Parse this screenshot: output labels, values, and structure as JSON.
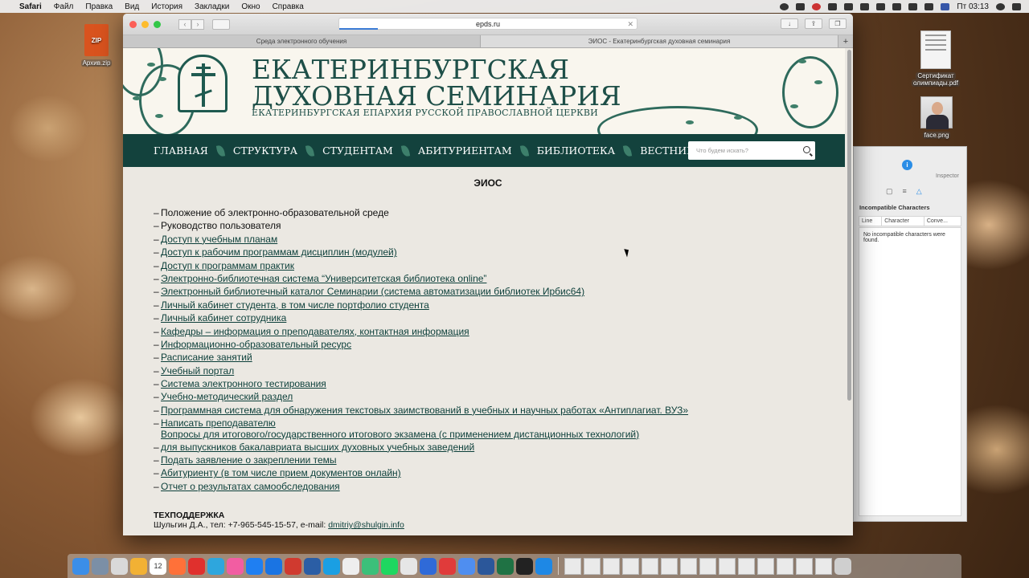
{
  "menubar": {
    "app": "Safari",
    "items": [
      "Файл",
      "Правка",
      "Вид",
      "История",
      "Закладки",
      "Окно",
      "Справка"
    ],
    "clock": "Пт 03:13"
  },
  "desktop": {
    "zip_label": "Архив.zip",
    "zip_badge": "ZIP",
    "pdf_label_1": "Сертификат",
    "pdf_label_2": "олимпиады.pdf",
    "png_label": "face.png"
  },
  "inspector": {
    "info_glyph": "i",
    "title": "Inspector",
    "heading": "Incompatible Characters",
    "columns": [
      "Line",
      "Character",
      "Conve..."
    ],
    "result": "No incompatible characters were found."
  },
  "browser": {
    "url": "epds.ru",
    "load_progress": 0.13,
    "tabs": [
      {
        "label": "Среда электронного обучения",
        "active": false
      },
      {
        "label": "ЭИОС - Екатеринбургская духовная семинария",
        "active": true
      }
    ]
  },
  "site": {
    "title_line1": "ЕКАТЕРИНБУРГСКАЯ",
    "title_line2": "ДУХОВНАЯ СЕМИНАРИЯ",
    "subtitle": "ЕКАТЕРИНБУРГСКАЯ ЕПАРХИЯ РУССКОЙ ПРАВОСЛАВНОЙ ЦЕРКВИ",
    "nav": [
      "ГЛАВНАЯ",
      "СТРУКТУРА",
      "СТУДЕНТАМ",
      "АБИТУРИЕНТАМ",
      "БИБЛИОТЕКА",
      "ВЕСТНИК ЕДС"
    ],
    "search_placeholder": "Что будем искать?",
    "page_title": "ЭИОС",
    "links": [
      {
        "text": "Положение об электронно-образовательной среде",
        "link": false
      },
      {
        "text": "Руководство пользователя",
        "link": false
      },
      {
        "text": "Доступ к учебным планам",
        "link": true
      },
      {
        "text": "Доступ к рабочим программам дисциплин (модулей)",
        "link": true
      },
      {
        "text": "Доступ к программам практик",
        "link": true
      },
      {
        "text": "Электронно-библиотечная система “Университетская библиотека online”",
        "link": true
      },
      {
        "text": "Электронный библиотечный каталог Семинарии (система автоматизации библиотек Ирбис64)",
        "link": true
      },
      {
        "text": "Личный кабинет студента, в том числе портфолио студента",
        "link": true
      },
      {
        "text": "Личный кабинет сотрудника",
        "link": true
      },
      {
        "text": "Кафедры – информация о преподавателях, контактная информация",
        "link": true
      },
      {
        "text": "Информационно-образовательный ресурс",
        "link": true
      },
      {
        "text": "Расписание занятий",
        "link": true
      },
      {
        "text": "Учебный портал",
        "link": true
      },
      {
        "text": "Система электронного тестирования",
        "link": true
      },
      {
        "text": "Учебно-методический раздел",
        "link": true
      },
      {
        "text": "Программная система для обнаружения текстовых заимствований в учебных и научных работах «Антиплагиат. ВУЗ»",
        "link": true
      },
      {
        "text": "Написать преподавателю",
        "link": true
      },
      {
        "text": "Вопросы для итогового/государственного итогового экзамена (с применением дистанционных технологий)",
        "link": true,
        "indent": true
      },
      {
        "text": "для выпускников бакалавриата высших духовных учебных заведений",
        "link": true
      },
      {
        "text": "Подать заявление о закреплении темы",
        "link": true
      },
      {
        "text": "Абитуриенту (в том числе прием документов онлайн)",
        "link": true
      },
      {
        "text": "Отчет о результатах самообследования",
        "link": true
      }
    ],
    "dash": "–",
    "support_label": "ТЕХПОДДЕРЖКА",
    "support_text": "Шульгин Д.А., тел: +7-965-545-15-57, e-mail: ",
    "support_email": "dmitriy@shulgin.info"
  },
  "dock": {
    "calendar_day": "12",
    "icons": [
      "finder-icon",
      "launchpad-icon",
      "notes-icon",
      "chrome-icon",
      "calendar-icon",
      "firefox-icon",
      "opera-icon",
      "telegram-icon",
      "itunes-icon",
      "appstore-icon",
      "trello-icon",
      "tool-icon",
      "bitwarden-icon",
      "skype-icon",
      "ia-writer-icon",
      "affinity-icon",
      "spotify-icon",
      "chrome2-icon",
      "cloud-icon",
      "anydesk-icon",
      "browser-icon",
      "word-icon",
      "excel-icon",
      "quicktime-icon",
      "safari-icon"
    ]
  },
  "colors": {
    "nav_bg": "#13423d",
    "title_green": "#1e4f48",
    "link_color": "#0c3f3a"
  }
}
